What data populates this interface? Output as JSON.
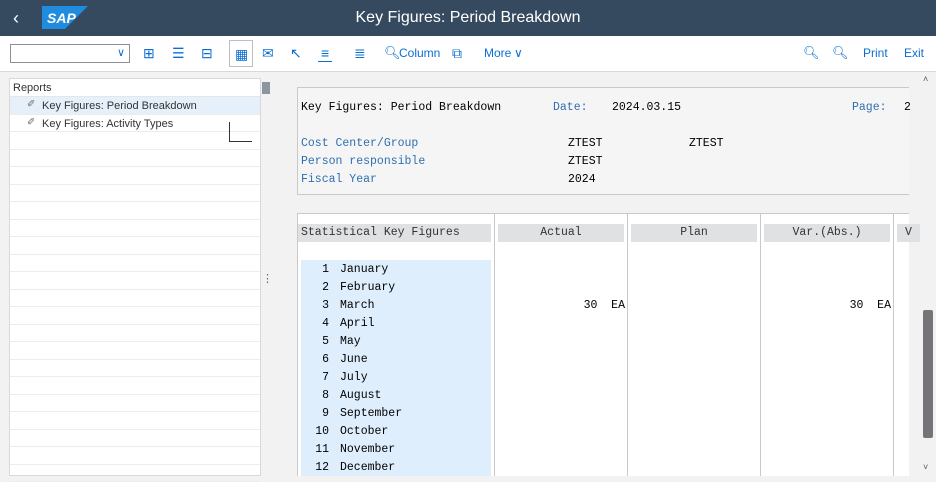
{
  "window": {
    "title": "Key Figures: Period Breakdown",
    "logo_text": "SAP"
  },
  "toolbar": {
    "column_label": "Column",
    "more_label": "More",
    "print_label": "Print",
    "exit_label": "Exit"
  },
  "nav_tree": {
    "header": "Reports",
    "items": [
      {
        "label": "Key Figures: Period Breakdown",
        "selected": true
      },
      {
        "label": "Key Figures: Activity Types",
        "selected": false
      }
    ]
  },
  "report": {
    "title": "Key Figures: Period Breakdown",
    "date_label": "Date:",
    "date_value": "2024.03.15",
    "page_label": "Page:",
    "page_value": "2",
    "fields": [
      {
        "label": "Cost Center/Group",
        "value1": "ZTEST",
        "value2": "ZTEST"
      },
      {
        "label": "Person responsible",
        "value1": "ZTEST",
        "value2": ""
      },
      {
        "label": "Fiscal Year",
        "value1": "2024",
        "value2": ""
      }
    ],
    "columns": [
      "Statistical Key Figures",
      "Actual",
      "Plan",
      "Var.(Abs.)",
      "V"
    ],
    "rows": [
      {
        "num": "1",
        "month": "January",
        "actual": "",
        "var": ""
      },
      {
        "num": "2",
        "month": "February",
        "actual": "",
        "var": ""
      },
      {
        "num": "3",
        "month": "March",
        "actual": "30  EA",
        "var": "30  EA"
      },
      {
        "num": "4",
        "month": "April",
        "actual": "",
        "var": ""
      },
      {
        "num": "5",
        "month": "May",
        "actual": "",
        "var": ""
      },
      {
        "num": "6",
        "month": "June",
        "actual": "",
        "var": ""
      },
      {
        "num": "7",
        "month": "July",
        "actual": "",
        "var": ""
      },
      {
        "num": "8",
        "month": "August",
        "actual": "",
        "var": ""
      },
      {
        "num": "9",
        "month": "September",
        "actual": "",
        "var": ""
      },
      {
        "num": "10",
        "month": "October",
        "actual": "",
        "var": ""
      },
      {
        "num": "11",
        "month": "November",
        "actual": "",
        "var": ""
      },
      {
        "num": "12",
        "month": "December",
        "actual": "",
        "var": ""
      }
    ]
  },
  "colors": {
    "shell": "#354a5f",
    "accent": "#0a6ed1",
    "selection": "#e5f0fa",
    "row_highlight": "#dfeefc",
    "field_label": "#2f6fb0"
  }
}
